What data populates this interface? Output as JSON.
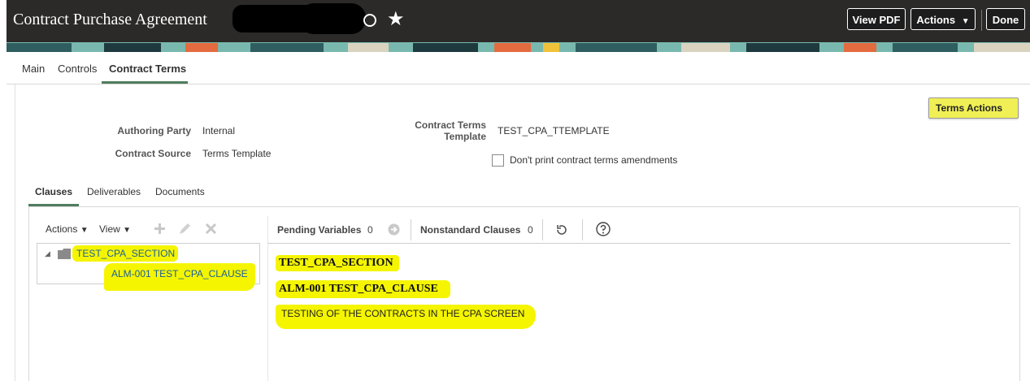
{
  "header": {
    "title": "Contract Purchase Agreement",
    "buttons": {
      "view_pdf": "View PDF",
      "actions": "Actions",
      "actions_caret": "▼",
      "done": "Done"
    }
  },
  "tabs": [
    "Main",
    "Controls",
    "Contract Terms"
  ],
  "terms": {
    "authoring_party_label": "Authoring Party",
    "authoring_party_value": "Internal",
    "contract_source_label": "Contract Source",
    "contract_source_value": "Terms Template",
    "template_label_line1": "Contract Terms",
    "template_label_line2": "Template",
    "template_value": "TEST_CPA_TTEMPLATE",
    "dont_print_label": "Don't print contract terms amendments",
    "terms_actions_label": "Terms Actions"
  },
  "subtabs": [
    "Clauses",
    "Deliverables",
    "Documents"
  ],
  "tree_toolbar": {
    "actions": "Actions",
    "view": "View"
  },
  "tree": {
    "section": "TEST_CPA_SECTION",
    "clause": "ALM-001 TEST_CPA_CLAUSE"
  },
  "right_toolbar": {
    "pending_label": "Pending Variables",
    "pending_count": "0",
    "nonstandard_label": "Nonstandard Clauses",
    "nonstandard_count": "0"
  },
  "preview": {
    "section": "TEST_CPA_SECTION",
    "clause": "ALM-001 TEST_CPA_CLAUSE",
    "text": "TESTING OF THE CONTRACTS IN THE CPA SCREEN"
  },
  "colors": {
    "header_bg": "#2b2a29",
    "highlight": "#f5f500",
    "tab_accent": "#4f7d5e",
    "link": "#1a5f9e"
  }
}
